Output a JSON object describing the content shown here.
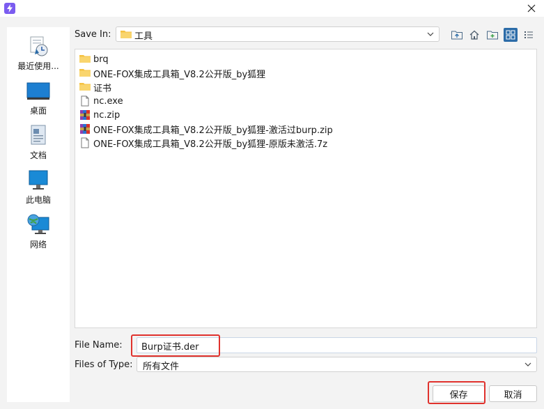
{
  "window": {
    "app_icon": "bolt-icon",
    "close_icon": "close-icon"
  },
  "places": [
    {
      "label": "最近使用...",
      "icon": "recent-icon"
    },
    {
      "label": "桌面",
      "icon": "desktop-icon"
    },
    {
      "label": "文档",
      "icon": "documents-icon"
    },
    {
      "label": "此电脑",
      "icon": "computer-icon"
    },
    {
      "label": "网络",
      "icon": "network-icon"
    }
  ],
  "look_in": {
    "label": "Save In:",
    "value": "工具"
  },
  "toolbar": [
    "up-folder-icon",
    "home-icon",
    "new-folder-icon",
    "list-view-icon",
    "details-view-icon"
  ],
  "files": [
    {
      "name": "brq",
      "type": "folder"
    },
    {
      "name": "ONE-FOX集成工具箱_V8.2公开版_by狐狸",
      "type": "folder"
    },
    {
      "name": "证书",
      "type": "folder"
    },
    {
      "name": "nc.exe",
      "type": "file"
    },
    {
      "name": "nc.zip",
      "type": "archive"
    },
    {
      "name": "ONE-FOX集成工具箱_V8.2公开版_by狐狸-激活过burp.zip",
      "type": "archive"
    },
    {
      "name": "ONE-FOX集成工具箱_V8.2公开版_by狐狸-原版未激活.7z",
      "type": "file"
    }
  ],
  "file_name": {
    "label": "File Name:",
    "value": "Burp证书.der"
  },
  "file_type": {
    "label": "Files of Type:",
    "value": "所有文件"
  },
  "buttons": {
    "save": "保存",
    "cancel": "取消"
  },
  "colors": {
    "highlight": "#e0322d",
    "accent": "#2c6ca8",
    "folder": "#f5c242"
  }
}
